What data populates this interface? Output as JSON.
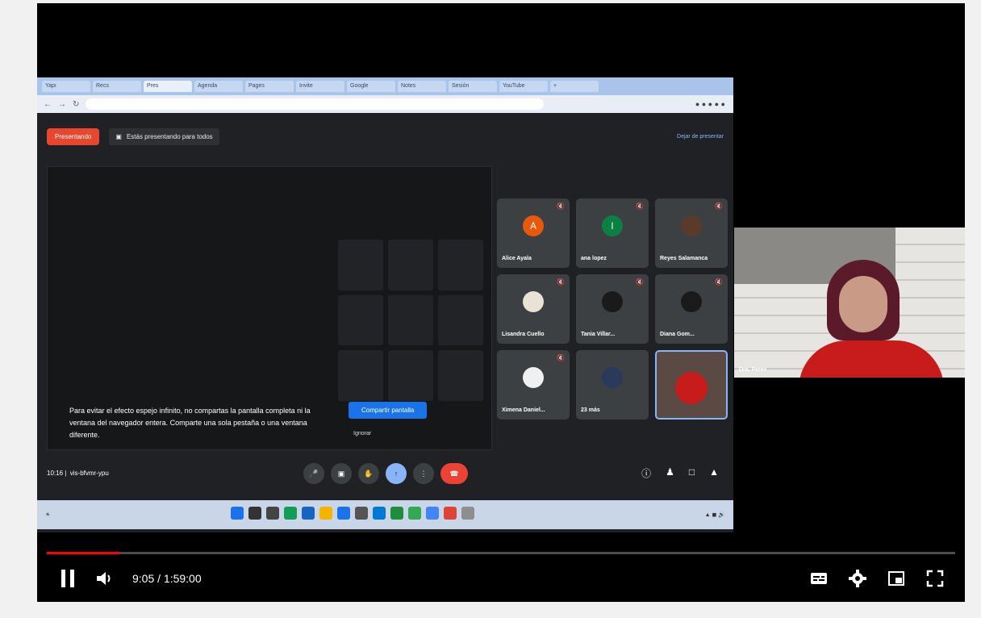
{
  "player": {
    "time_current": "9:05",
    "time_separator": " / ",
    "time_total": "1:59:00",
    "progress_fraction": 0.08,
    "accent_color": "#ff0000"
  },
  "browser": {
    "tabs": [
      "Yapı",
      "Recs",
      "Pres",
      "Agenda",
      "Pages",
      "Invite",
      "Google",
      "Notes",
      "Sesión",
      "YouTube",
      "+"
    ]
  },
  "meet": {
    "presenting_label": "Presentando",
    "message": "Estás presentando para todos",
    "stop_label": "Dejar de presentar",
    "warning": "Para evitar el efecto espejo infinito, no compartas la pantalla completa ni la ventana del navegador entera. Comparte una sola pestaña o una ventana diferente.",
    "share_button": "Compartir pantalla",
    "ignore_label": "Ignorar",
    "clock": "10:16",
    "meeting_code": "vis-bfvmr-ypu"
  },
  "participants": [
    {
      "name": "Alice Ayala",
      "initial": "A",
      "color": "#e8590c"
    },
    {
      "name": "ana lopez",
      "initial": "l",
      "color": "#0b8043"
    },
    {
      "name": "Reyes Salamanca",
      "initial": "",
      "color": "#5a3a2a"
    },
    {
      "name": "Lisandra Cuello",
      "initial": "",
      "color": "#8a9a7a"
    },
    {
      "name": "Tania Villar...",
      "initial": "",
      "color": "#444"
    },
    {
      "name": "Diana Gom...",
      "initial": "",
      "color": "#444"
    },
    {
      "name": "Ximena Daniel...",
      "initial": "",
      "color": "#444"
    },
    {
      "name": "23 más",
      "initial": "",
      "color": "#2a3a5a"
    },
    {
      "name": "",
      "initial": "",
      "color": "#5a4a43"
    }
  ],
  "camera": {
    "name": "Dra. Perez"
  }
}
